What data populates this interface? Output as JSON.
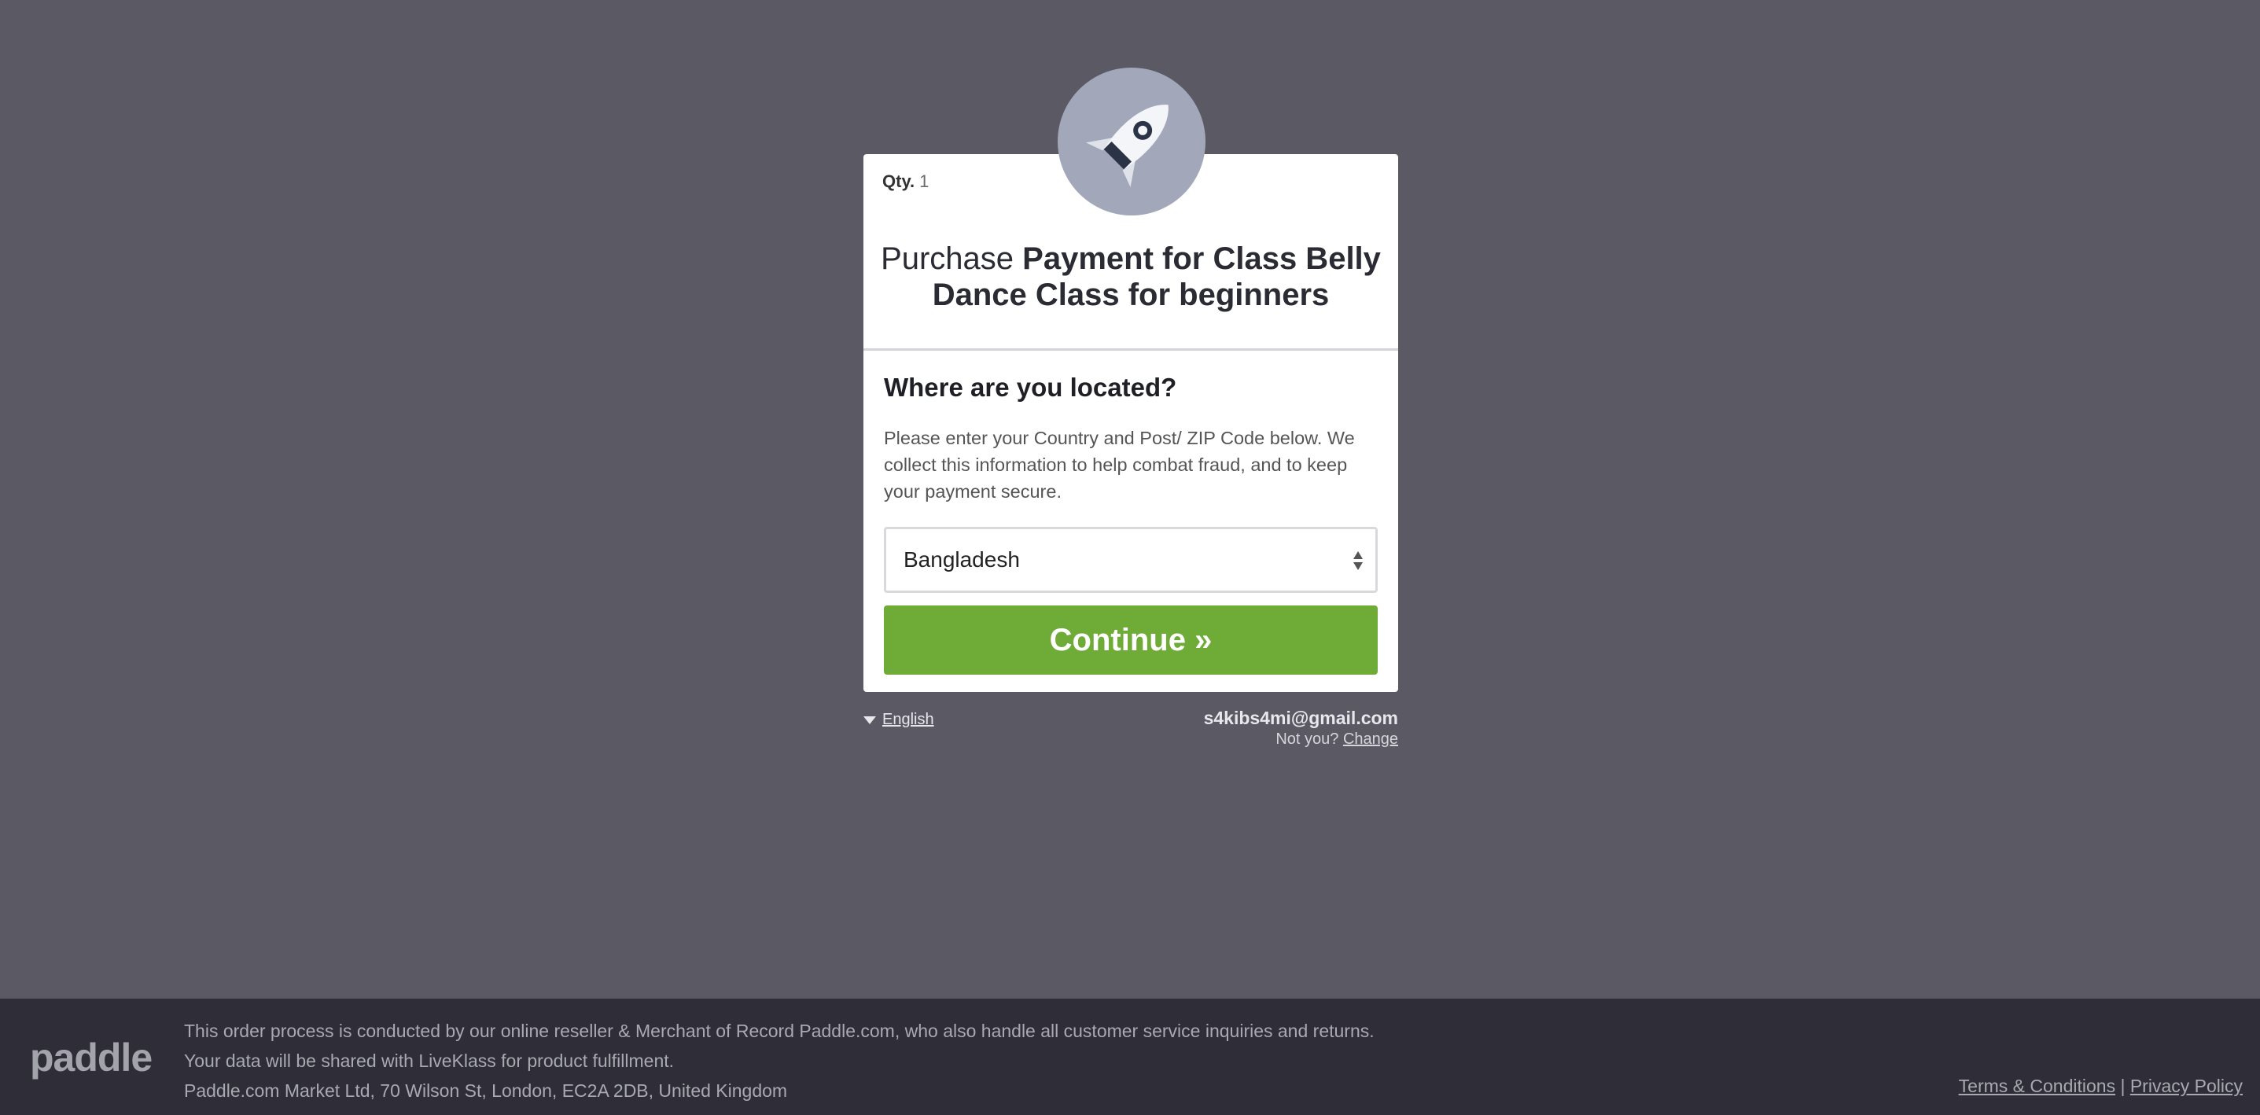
{
  "product": {
    "qty_label": "Qty.",
    "qty_value": "1",
    "title_lead": "Purchase",
    "title_product": "Payment for Class Belly Dance Class for beginners"
  },
  "location": {
    "heading": "Where are you located?",
    "description": "Please enter your Country and Post/ ZIP Code below. We collect this information to help combat fraud, and to keep your payment secure.",
    "country_selected": "Bangladesh",
    "continue_label": "Continue »"
  },
  "language": {
    "label": "English"
  },
  "account": {
    "email": "s4kibs4mi@gmail.com",
    "not_you": "Not you?",
    "change_label": "Change"
  },
  "footer": {
    "logo_text": "paddle",
    "line1": "This order process is conducted by our online reseller & Merchant of Record Paddle.com, who also handle all customer service inquiries and returns.",
    "line2": "Your data will be shared with LiveKlass for product fulfillment.",
    "line3": "Paddle.com Market Ltd, 70 Wilson St, London, EC2A 2DB, United Kingdom",
    "terms_label": "Terms & Conditions",
    "separator": "|",
    "privacy_label": "Privacy Policy"
  },
  "colors": {
    "page_bg": "#5a5964",
    "footer_bg": "#2f2e38",
    "button": "#6fab37",
    "logo_circle": "#a2a8b9"
  },
  "icons": [
    "rocket-icon",
    "select-arrows-icon",
    "caret-down-icon"
  ]
}
